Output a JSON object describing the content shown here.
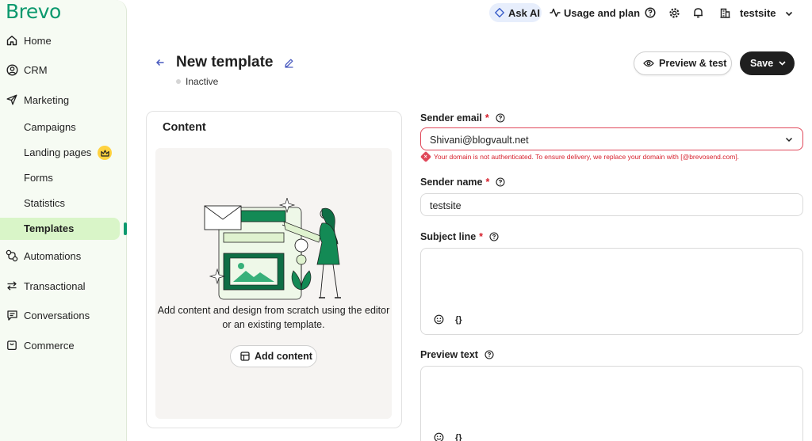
{
  "app": {
    "logo": "Brevo"
  },
  "sidebar": {
    "items": [
      {
        "label": "Home",
        "icon": "home-icon"
      },
      {
        "label": "CRM",
        "icon": "contact-icon"
      },
      {
        "label": "Marketing",
        "icon": "paper-plane-icon"
      },
      {
        "label": "Campaigns"
      },
      {
        "label": "Landing pages",
        "icon": "crown-icon"
      },
      {
        "label": "Forms"
      },
      {
        "label": "Statistics"
      },
      {
        "label": "Templates"
      },
      {
        "label": "Automations",
        "icon": "automation-icon"
      },
      {
        "label": "Transactional",
        "icon": "transfer-icon"
      },
      {
        "label": "Conversations",
        "icon": "chat-icon"
      },
      {
        "label": "Commerce",
        "icon": "bag-icon"
      }
    ]
  },
  "topbar": {
    "ask_ai": "Ask AI",
    "usage": "Usage and plan",
    "account": "testsite"
  },
  "header": {
    "title": "New template",
    "status": "Inactive",
    "preview_label": "Preview & test",
    "save_label": "Save"
  },
  "content": {
    "title": "Content",
    "description": "Add content and design from scratch using the editor or an existing template.",
    "add_label": "Add content"
  },
  "form": {
    "sender_email": {
      "label": "Sender email",
      "value": "Shivani@blogvault.net",
      "error": "Your domain is not authenticated. To ensure delivery, we replace your domain with [@brevosend.com]."
    },
    "sender_name": {
      "label": "Sender name",
      "value": "testsite"
    },
    "subject": {
      "label": "Subject line",
      "value": ""
    },
    "preview_text": {
      "label": "Preview text",
      "value": ""
    },
    "personalize_label": "{}"
  },
  "colors": {
    "brand": "#0b996e",
    "active_bg": "#d9f5c8",
    "error": "#d61f2c",
    "ai_bg": "#e7eefc"
  }
}
